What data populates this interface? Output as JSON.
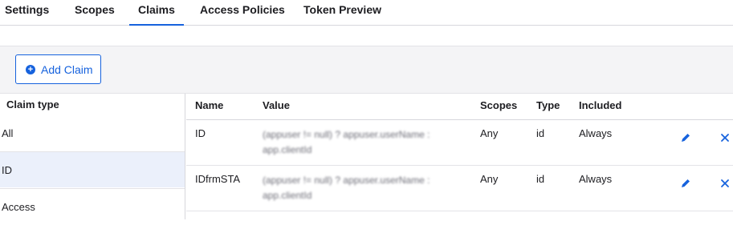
{
  "tabs": [
    "Settings",
    "Scopes",
    "Claims",
    "Access Policies",
    "Token Preview"
  ],
  "active_tab": "Claims",
  "toolbar": {
    "add_claim_label": "Add Claim"
  },
  "claim_types": {
    "title": "Claim type",
    "items": [
      "All",
      "ID",
      "Access"
    ],
    "selected": "ID"
  },
  "table": {
    "headers": [
      "Name",
      "Value",
      "Scopes",
      "Type",
      "Included"
    ],
    "rows": [
      {
        "name": "ID",
        "value": "(appuser != null) ? appuser.userName : app.clientId",
        "scopes": "Any",
        "type": "id",
        "included": "Always"
      },
      {
        "name": "IDfrmSTA",
        "value": "(appuser != null) ? appuser.userName : app.clientId",
        "scopes": "Any",
        "type": "id",
        "included": "Always"
      }
    ]
  },
  "colors": {
    "accent": "#1662dd",
    "selected_row": "#ebf0fb",
    "toolbar_bg": "#f4f4f6"
  },
  "icons": {
    "add": "plus-circle-icon",
    "edit": "pencil-icon",
    "delete": "close-icon"
  }
}
